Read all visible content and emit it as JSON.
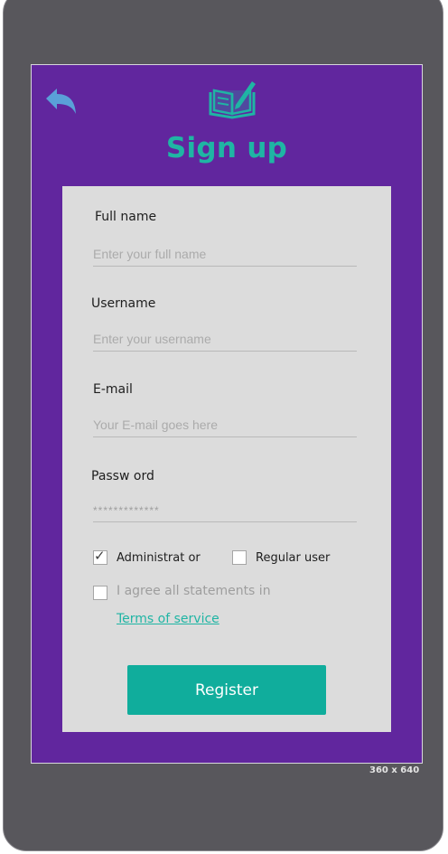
{
  "header": {
    "title": "Sign up",
    "back_icon": "back-arrow-icon",
    "logo_icon": "book-pencil-icon"
  },
  "form": {
    "full_name": {
      "label": "Full name",
      "placeholder": "Enter your full name",
      "value": ""
    },
    "username": {
      "label": "Username",
      "placeholder": "Enter your username",
      "value": ""
    },
    "email": {
      "label": "E-mail",
      "placeholder": "Your E-mail goes here",
      "value": ""
    },
    "password": {
      "label": "Passw ord",
      "placeholder": "*************",
      "value": ""
    },
    "roles": [
      {
        "label": "Administrat or",
        "checked": true
      },
      {
        "label": "Regular user",
        "checked": false
      }
    ],
    "agree": {
      "label": "I agree all statements in",
      "checked": false
    },
    "terms_link": "Terms of service",
    "register_label": "Register"
  },
  "frame_size_label": "360 x 640",
  "colors": {
    "frame": "#58575c",
    "screen_bg": "#61269e",
    "card_bg": "#dcdcdc",
    "accent": "#10ad9c",
    "title": "#1fb5a4",
    "back_icon": "#5aa0d8"
  }
}
